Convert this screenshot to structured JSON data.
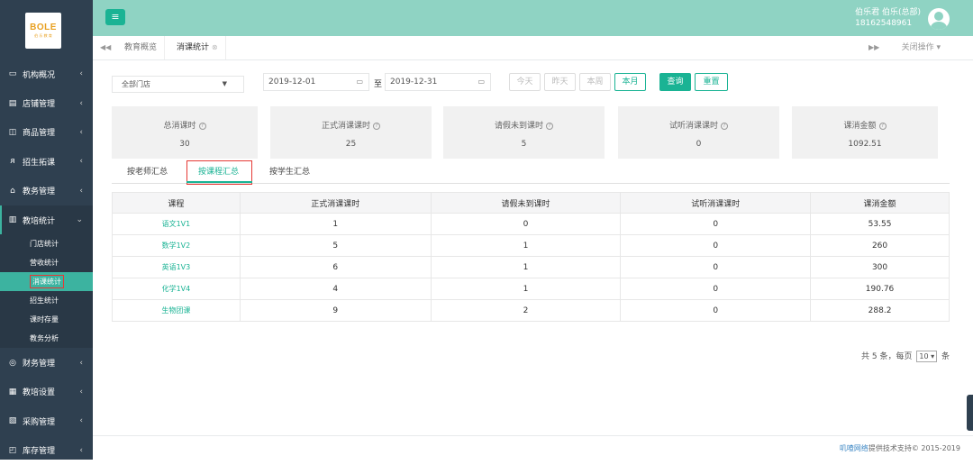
{
  "logo": {
    "main": "BOLE",
    "sub": "伯 乐 教 育"
  },
  "sidebar": {
    "items": [
      {
        "label": "机构概况",
        "icon": "monitor-icon"
      },
      {
        "label": "店铺管理",
        "icon": "store-icon"
      },
      {
        "label": "商品管理",
        "icon": "bag-icon"
      },
      {
        "label": "招生拓课",
        "icon": "user-icon"
      },
      {
        "label": "教务管理",
        "icon": "cap-icon"
      }
    ],
    "open_item": {
      "label": "教培统计",
      "icon": "chart-icon"
    },
    "sub_items": [
      "门店统计",
      "营收统计",
      "消课统计",
      "招生统计",
      "课时存量",
      "教务分析"
    ],
    "active_sub": "消课统计",
    "items_after": [
      {
        "label": "财务管理",
        "icon": "coin-icon"
      },
      {
        "label": "教培设置",
        "icon": "grid-icon"
      },
      {
        "label": "采购管理",
        "icon": "cart-icon"
      },
      {
        "label": "库存管理",
        "icon": "box-icon"
      }
    ]
  },
  "topbar": {
    "user_name": "伯乐君 伯乐(总部)",
    "user_phone": "18162548961"
  },
  "tabs": {
    "items": [
      "教育概览",
      "消课统计"
    ],
    "close_ops": "关闭操作"
  },
  "filters": {
    "store": "全部门店",
    "date_from": "2019-12-01",
    "date_sep": "至",
    "date_to": "2019-12-31",
    "quick": [
      "今天",
      "昨天",
      "本周",
      "本月"
    ],
    "query": "查询",
    "reset": "重置"
  },
  "summary": [
    {
      "label": "总消课时",
      "value": "30"
    },
    {
      "label": "正式消课课时",
      "value": "25"
    },
    {
      "label": "请假未到课时",
      "value": "5"
    },
    {
      "label": "试听消课课时",
      "value": "0"
    },
    {
      "label": "课消金额",
      "value": "1092.51"
    }
  ],
  "subtabs": [
    "按老师汇总",
    "按课程汇总",
    "按学生汇总"
  ],
  "table": {
    "headers": [
      "课程",
      "正式消课课时",
      "请假未到课时",
      "试听消课课时",
      "课消金额"
    ],
    "rows": [
      [
        "语文1V1",
        "1",
        "0",
        "0",
        "53.55"
      ],
      [
        "数学1V2",
        "5",
        "1",
        "0",
        "260"
      ],
      [
        "英语1V3",
        "6",
        "1",
        "0",
        "300"
      ],
      [
        "化学1V4",
        "4",
        "1",
        "0",
        "190.76"
      ],
      [
        "生物团课",
        "9",
        "2",
        "0",
        "288.2"
      ]
    ]
  },
  "pager": {
    "prefix": "共 5 条，每页",
    "size": "10",
    "suffix": "条"
  },
  "footer": {
    "company": "叽喳网络",
    "text": "提供技术支持© 2015-2019"
  },
  "colors": {
    "accent": "#1ab394",
    "sidebar": "#2f4050",
    "topbar": "#8fd3c3",
    "highlight": "#e53935"
  }
}
